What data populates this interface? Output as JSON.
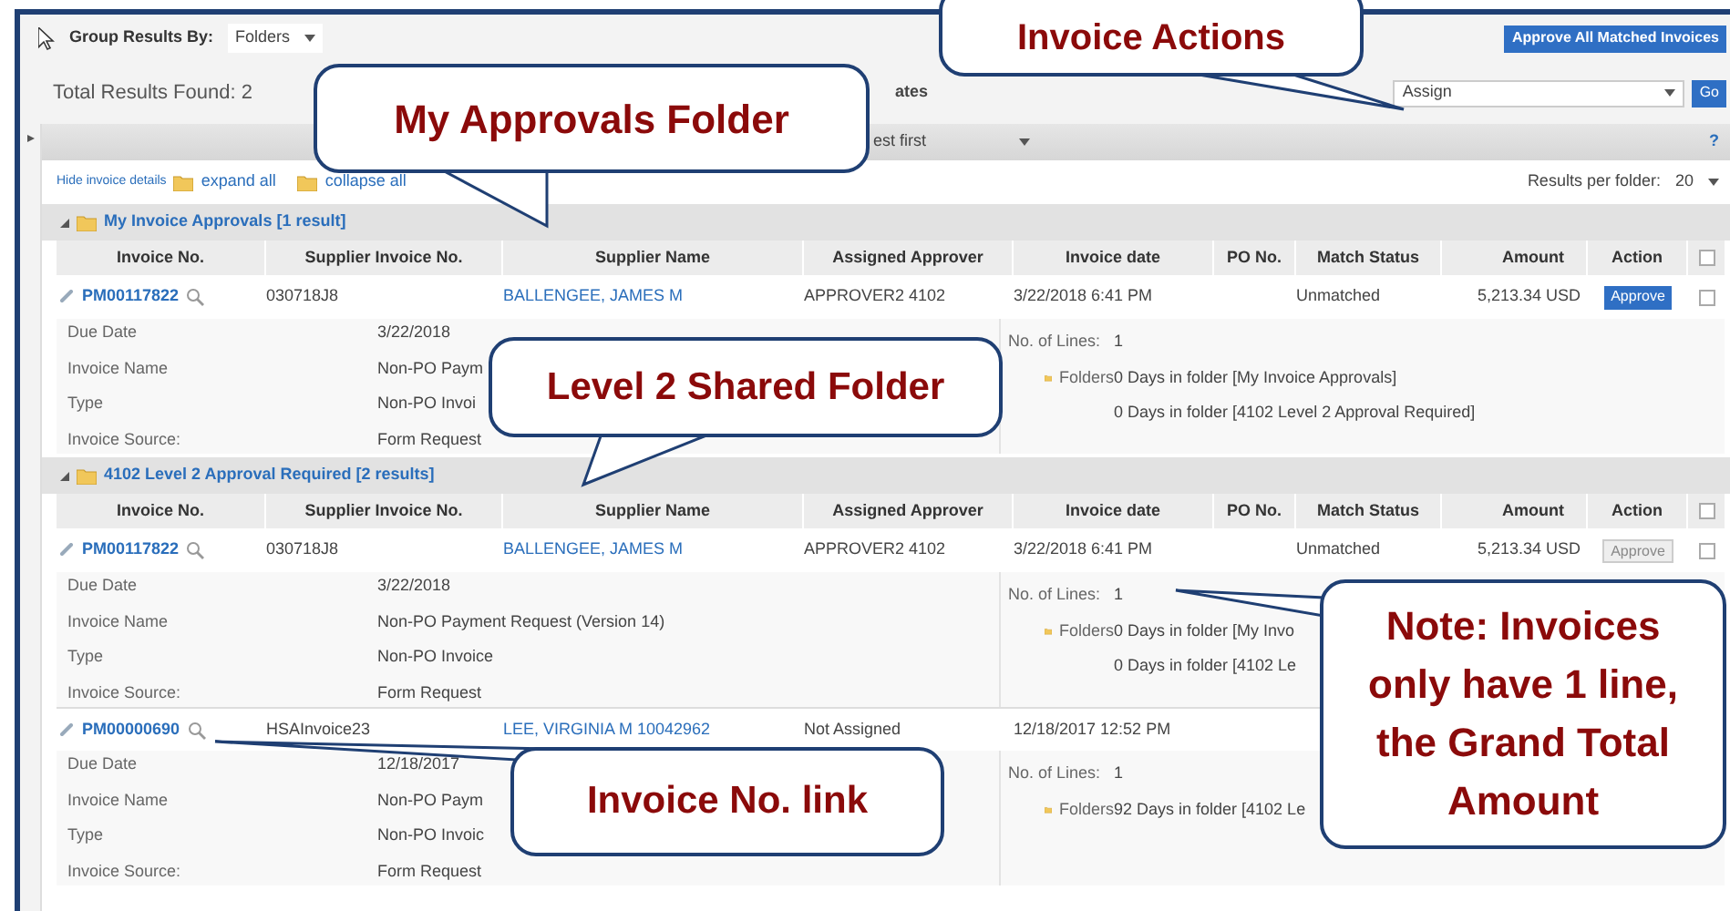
{
  "group_by": {
    "label": "Group Results By:",
    "value": "Folders"
  },
  "approve_all_button": "Approve All Matched Invoices",
  "total_results": "Total Results Found: 2",
  "filter_label": "ates",
  "action_select": {
    "value": "Assign"
  },
  "go_button": "Go",
  "sort_select": {
    "value": "est first"
  },
  "help": "?",
  "links": [
    {
      "kind": "text",
      "label": "Hide invoice details"
    },
    {
      "kind": "folder",
      "label": "expand all"
    },
    {
      "kind": "folder",
      "label": "collapse all"
    }
  ],
  "results_per_folder": {
    "label": "Results per folder:",
    "value": "20"
  },
  "folders": [
    {
      "title": "My Invoice Approvals [1 result]",
      "expanded": true,
      "select_all_checked": false,
      "columns": [
        "Invoice No.",
        "Supplier Invoice No.",
        "Supplier Name",
        "Assigned Approver",
        "Invoice date",
        "PO No.",
        "Match Status",
        "Amount",
        "Action"
      ],
      "invoices": [
        {
          "invoice_no": "PM00117822",
          "supplier_invoice_no": "030718J8",
          "supplier_name": "BALLENGEE, JAMES M",
          "assigned_approver": "APPROVER2 4102",
          "invoice_date": "3/22/2018 6:41 PM",
          "match_status": "Unmatched",
          "amount": "5,213.34 USD",
          "action": {
            "label": "Approve",
            "disabled": false
          },
          "checked": false,
          "details": [
            {
              "label": "Due Date",
              "value": "3/22/2018"
            },
            {
              "label": "Invoice Name",
              "value": "Non-PO Paym"
            },
            {
              "label": "Type",
              "value": "Non-PO Invoi"
            },
            {
              "label": "Invoice Source:",
              "value": "Form Request"
            }
          ],
          "lines": {
            "label": "No. of Lines:",
            "value": "1"
          },
          "folder_days": {
            "label": "Folders",
            "values": [
              "0 Days in folder [My Invoice Approvals]",
              "0 Days in folder [4102 Level 2 Approval Required]"
            ]
          }
        }
      ]
    },
    {
      "title": "4102 Level 2 Approval Required [2 results]",
      "expanded": true,
      "select_all_checked": false,
      "columns": [
        "Invoice No.",
        "Supplier Invoice No.",
        "Supplier Name",
        "Assigned Approver",
        "Invoice date",
        "PO No.",
        "Match Status",
        "Amount",
        "Action"
      ],
      "invoices": [
        {
          "invoice_no": "PM00117822",
          "supplier_invoice_no": "030718J8",
          "supplier_name": "BALLENGEE, JAMES M",
          "assigned_approver": "APPROVER2 4102",
          "invoice_date": "3/22/2018 6:41 PM",
          "match_status": "Unmatched",
          "amount": "5,213.34 USD",
          "action": {
            "label": "Approve",
            "disabled": true
          },
          "checked": false,
          "details": [
            {
              "label": "Due Date",
              "value": "3/22/2018"
            },
            {
              "label": "Invoice Name",
              "value": "Non-PO Payment Request (Version 14)"
            },
            {
              "label": "Type",
              "value": "Non-PO Invoice"
            },
            {
              "label": "Invoice Source:",
              "value": "Form Request"
            }
          ],
          "lines": {
            "label": "No. of Lines:",
            "value": "1"
          },
          "folder_days": {
            "label": "Folders",
            "values": [
              "0 Days in folder [My Invo",
              "0 Days in folder [4102 Le"
            ]
          }
        },
        {
          "invoice_no": "PM00000690",
          "supplier_invoice_no": "HSAInvoice23",
          "supplier_name": "LEE, VIRGINIA M 10042962",
          "assigned_approver": "Not Assigned",
          "invoice_date": "12/18/2017 12:52 PM",
          "details": [
            {
              "label": "Due Date",
              "value": "12/18/2017"
            },
            {
              "label": "Invoice Name",
              "value": "Non-PO Paym"
            },
            {
              "label": "Type",
              "value": "Non-PO Invoic"
            },
            {
              "label": "Invoice Source:",
              "value": "Form Request"
            }
          ],
          "lines": {
            "label": "No. of Lines:",
            "value": "1"
          },
          "folder_days": {
            "label": "Folders",
            "values": [
              "92 Days in folder [4102 Le"
            ]
          }
        }
      ]
    }
  ],
  "callouts": [
    {
      "text": "Invoice Actions"
    },
    {
      "text": "My Approvals Folder"
    },
    {
      "text": "Level 2 Shared Folder"
    },
    {
      "text": "Invoice No. link"
    },
    {
      "text": "Note: Invoices only have 1 line, the Grand Total Amount"
    }
  ]
}
